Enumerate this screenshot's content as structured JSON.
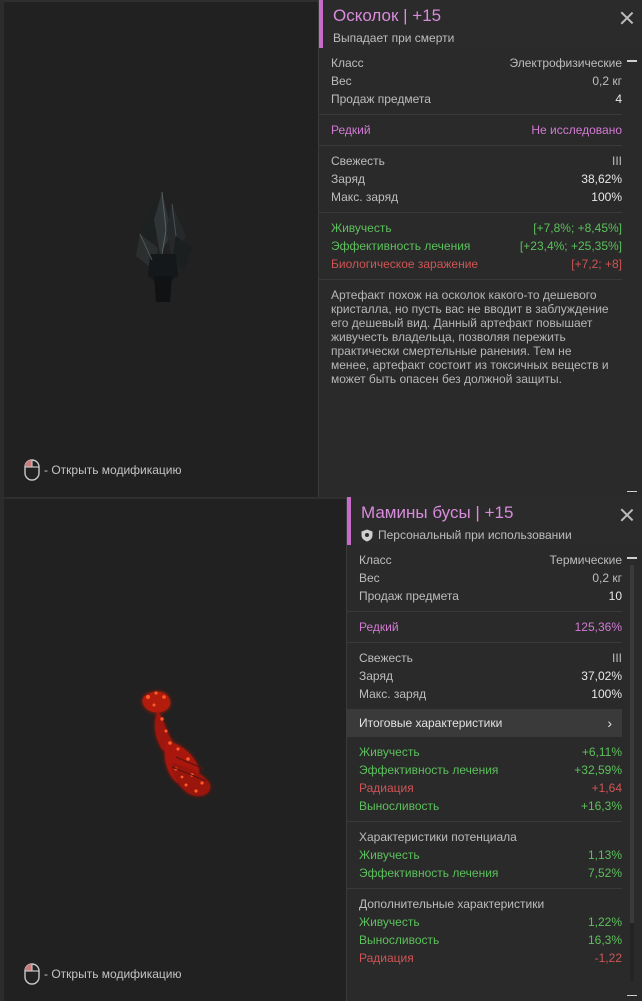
{
  "panels": [
    {
      "title": "Осколок | +15",
      "subtitle": "Выпадает при смерти",
      "props": [
        {
          "k": "Класс",
          "v": "Электрофизические"
        },
        {
          "k": "Вес",
          "v": "0,2 кг"
        },
        {
          "k": "Продаж предмета",
          "v": "4"
        }
      ],
      "rarity": {
        "k": "Редкий",
        "v": "Не исследовано"
      },
      "state": [
        {
          "k": "Свежесть",
          "v": "III"
        },
        {
          "k": "Заряд",
          "v": "38,62%"
        },
        {
          "k": "Макс. заряд",
          "v": "100%"
        }
      ],
      "effects": [
        {
          "k": "Живучесть",
          "v": "[+7,8%; +8,45%]",
          "color": "#5cc05c"
        },
        {
          "k": "Эффективность лечения",
          "v": "[+23,4%; +25,35%]",
          "color": "#5cc05c"
        },
        {
          "k": "Биологическое заражение",
          "v": "[+7,2; +8]",
          "color": "#d05454"
        }
      ],
      "description": "Артефакт похож на осколок какого-то дешевого кристалла, но пусть вас не вводит в заблуждение его дешевый вид. Данный артефакт повышает живучесть владельца, позволяя пережить практически смертельные ранения. Тем не менее, артефакт состоит из токсичных веществ и может быть опасен без должной защиты.",
      "footer": "- Открыть модификацию"
    },
    {
      "title": "Мамины бусы | +15",
      "subtitle": "Персональный при использовании",
      "props": [
        {
          "k": "Класс",
          "v": "Термические"
        },
        {
          "k": "Вес",
          "v": "0,2 кг"
        },
        {
          "k": "Продаж предмета",
          "v": "10"
        }
      ],
      "rarity": {
        "k": "Редкий",
        "v": "125,36%"
      },
      "state": [
        {
          "k": "Свежесть",
          "v": "III"
        },
        {
          "k": "Заряд",
          "v": "37,02%"
        },
        {
          "k": "Макс. заряд",
          "v": "100%"
        }
      ],
      "summary_label": "Итоговые характеристики",
      "summary": [
        {
          "k": "Живучесть",
          "v": "+6,11%",
          "color": "#5cc05c"
        },
        {
          "k": "Эффективность лечения",
          "v": "+32,59%",
          "color": "#5cc05c"
        },
        {
          "k": "Радиация",
          "v": "+1,64",
          "color": "#d05454"
        },
        {
          "k": "Выносливость",
          "v": "+16,3%",
          "color": "#5cc05c"
        }
      ],
      "potential_title": "Характеристики потенциала",
      "potential": [
        {
          "k": "Живучесть",
          "v": "1,13%",
          "color": "#5cc05c"
        },
        {
          "k": "Эффективность лечения",
          "v": "7,52%",
          "color": "#5cc05c"
        }
      ],
      "additional_title": "Дополнительные характеристики",
      "additional": [
        {
          "k": "Живучесть",
          "v": "1,22%",
          "color": "#5cc05c"
        },
        {
          "k": "Выносливость",
          "v": "16,3%",
          "color": "#5cc05c"
        },
        {
          "k": "Радиация",
          "v": "-1,22",
          "color": "#d05454"
        }
      ],
      "footer": "- Открыть модификацию"
    }
  ]
}
